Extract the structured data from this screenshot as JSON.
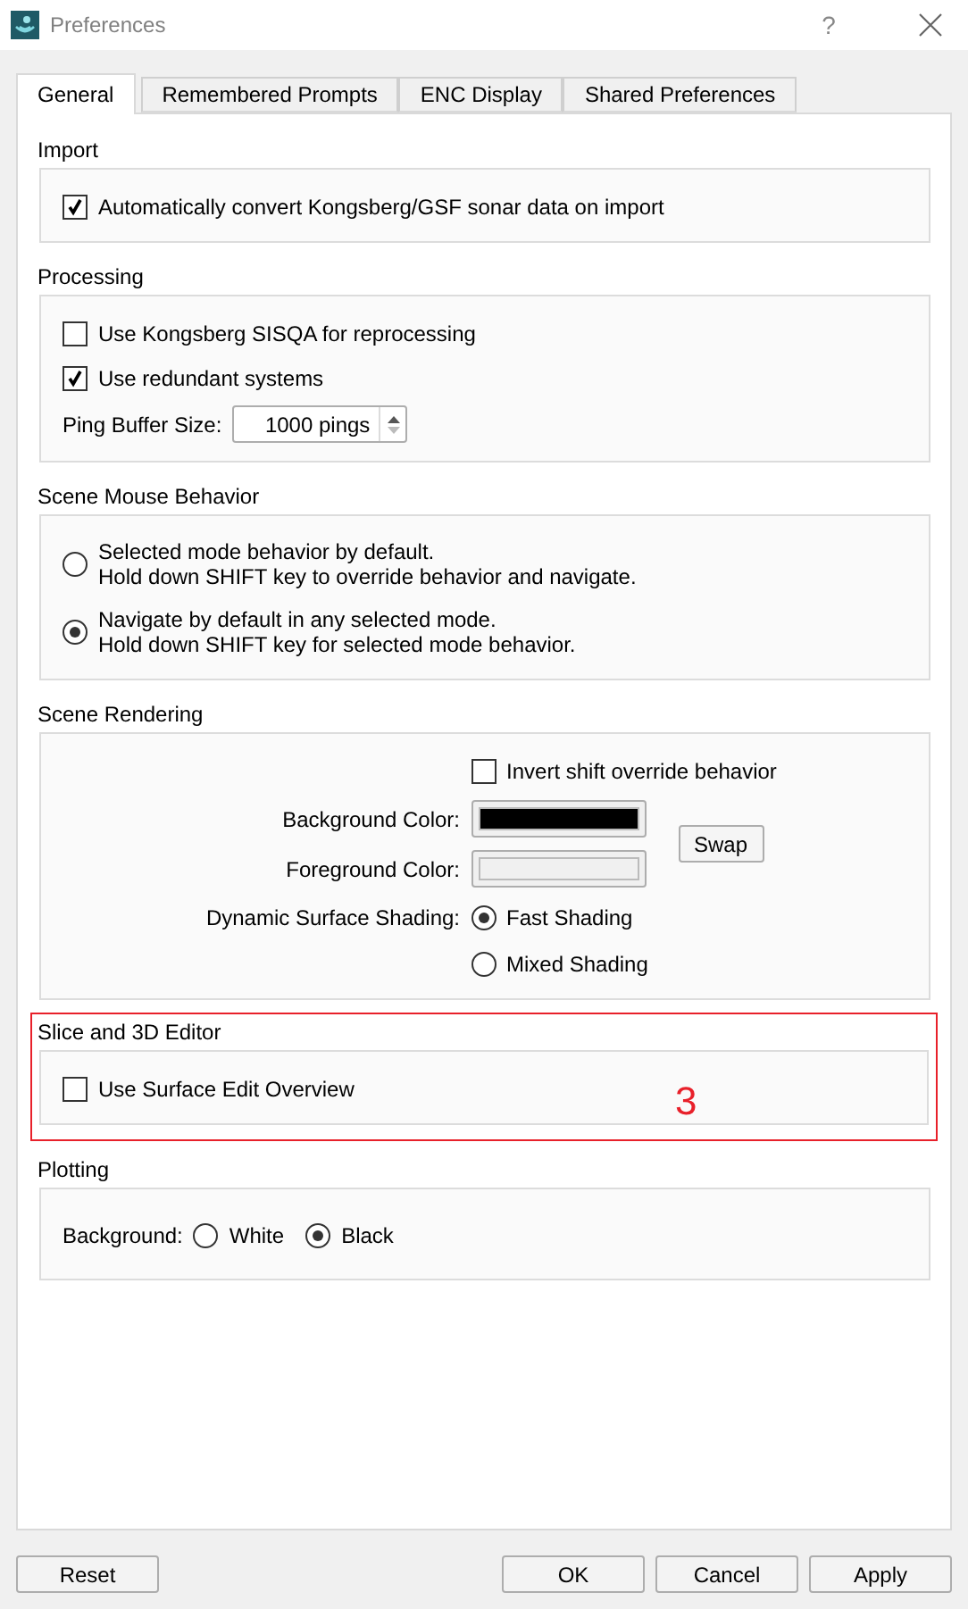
{
  "window": {
    "title": "Preferences",
    "help": "?"
  },
  "tabs": [
    {
      "label": "General",
      "selected": true
    },
    {
      "label": "Remembered Prompts",
      "selected": false
    },
    {
      "label": "ENC Display",
      "selected": false
    },
    {
      "label": "Shared Preferences",
      "selected": false
    }
  ],
  "sections": [
    {
      "title": "Import",
      "rows": [
        {
          "kind": "checkbox",
          "label": "Automatically convert Kongsberg/GSF sonar data on import",
          "checked": true
        }
      ]
    },
    {
      "title": "Processing",
      "rows": [
        {
          "kind": "checkbox",
          "label": "Use Kongsberg SISQA for reprocessing",
          "checked": false
        },
        {
          "kind": "checkbox",
          "label": "Use redundant systems",
          "checked": true
        },
        {
          "kind": "spinbox",
          "label": "Ping Buffer Size:",
          "value": "1000 pings"
        }
      ]
    },
    {
      "title": "Scene Mouse Behavior",
      "rows": [
        {
          "kind": "radio",
          "lines": [
            "Selected mode behavior by default.",
            "Hold down SHIFT key to override behavior and navigate."
          ],
          "selected": false
        },
        {
          "kind": "radio",
          "lines": [
            "Navigate by default in any selected mode.",
            "Hold down SHIFT key for selected mode behavior."
          ],
          "selected": true
        }
      ]
    },
    {
      "title": "Scene Rendering",
      "rows": [
        {
          "kind": "rendering",
          "invert": {
            "label": "Invert shift override behavior",
            "checked": false
          },
          "colors": [
            {
              "label": "Background Color:",
              "color": "#000000"
            },
            {
              "label": "Foreground Color:",
              "color": "#f0f0f0"
            }
          ],
          "swap": "Swap",
          "shading": {
            "label": "Dynamic Surface Shading:",
            "options": [
              {
                "label": "Fast Shading",
                "selected": true
              },
              {
                "label": "Mixed Shading",
                "selected": false
              }
            ]
          }
        }
      ]
    },
    {
      "title": "Slice and 3D Editor",
      "highlight": {
        "label": "3",
        "color": "#e8202a"
      },
      "rows": [
        {
          "kind": "checkbox",
          "label": "Use Surface Edit Overview",
          "checked": false
        }
      ]
    },
    {
      "title": "Plotting",
      "rows": [
        {
          "kind": "radiorow",
          "label": "Background:",
          "options": [
            {
              "label": "White",
              "selected": false
            },
            {
              "label": "Black",
              "selected": true
            }
          ]
        }
      ]
    }
  ],
  "footer": {
    "left": [
      "Reset"
    ],
    "right": [
      "OK",
      "Cancel",
      "Apply"
    ]
  }
}
